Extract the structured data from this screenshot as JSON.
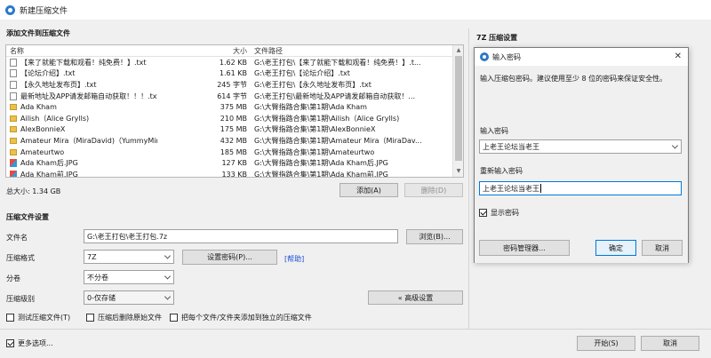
{
  "window": {
    "title": "新建压缩文件"
  },
  "add_files": {
    "section_label": "添加文件到压缩文件",
    "columns": {
      "name": "名称",
      "size": "大小",
      "path": "文件路径"
    },
    "rows": [
      {
        "name": "【来了就能下载和观看！纯免费！】.txt",
        "size": "1.62 KB",
        "path": "G:\\老王打包\\【来了就能下载和观看！纯免费！】.t...",
        "type": "txt"
      },
      {
        "name": "【论坛介绍】.txt",
        "size": "1.61 KB",
        "path": "G:\\老王打包\\【论坛介绍】.txt",
        "type": "txt"
      },
      {
        "name": "【永久地址发布页】.txt",
        "size": "245 字节",
        "path": "G:\\老王打包\\【永久地址发布页】.txt",
        "type": "txt"
      },
      {
        "name": "最新地址及APP请发邮箱自动获取！！！.txt",
        "size": "614 字节",
        "path": "G:\\老王打包\\最新地址及APP请发邮箱自动获取！...",
        "type": "txt"
      },
      {
        "name": "Ada Kham",
        "size": "375 MB",
        "path": "G:\\大臀指路合集\\第1期\\Ada Kham",
        "type": "folder"
      },
      {
        "name": "Ailish（Alice Grylls)",
        "size": "210 MB",
        "path": "G:\\大臀指路合集\\第1期\\Ailish（Alice Grylls)",
        "type": "folder"
      },
      {
        "name": "AlexBonnieX",
        "size": "175 MB",
        "path": "G:\\大臀指路合集\\第1期\\AlexBonnieX",
        "type": "folder"
      },
      {
        "name": "Amateur Mira（MiraDavid)（YummyMira)",
        "size": "432 MB",
        "path": "G:\\大臀指路合集\\第1期\\Amateur Mira（MiraDav...",
        "type": "folder"
      },
      {
        "name": "Amateurtwo",
        "size": "185 MB",
        "path": "G:\\大臀指路合集\\第1期\\Amateurtwo",
        "type": "folder"
      },
      {
        "name": "Ada Kham后.JPG",
        "size": "127 KB",
        "path": "G:\\大臀指路合集\\第1期\\Ada Kham后.JPG",
        "type": "image"
      },
      {
        "name": "Ada Kham前.JPG",
        "size": "133 KB",
        "path": "G:\\大臀指路合集\\第1期\\Ada Kham前.JPG",
        "type": "image"
      }
    ],
    "total": "总大小: 1.34 GB",
    "add_button": "添加(A)",
    "delete_button": "删除(D)"
  },
  "settings": {
    "section_label": "压缩文件设置",
    "filename_label": "文件名",
    "filename_value": "G:\\老王打包\\老王打包.7z",
    "browse_button": "浏览(B)...",
    "format_label": "压缩格式",
    "format_value": "7Z",
    "set_password_button": "设置密码(P)...",
    "help_link": "[帮助]",
    "split_label": "分卷",
    "split_value": "不分卷",
    "level_label": "压缩级别",
    "level_value": "0-仅存储",
    "advanced_button": "« 高级设置",
    "test_checkbox": "测试压缩文件(T)",
    "delete_source_checkbox": "压缩后删除原始文件",
    "separate_checkbox": "把每个文件/文件夹添加到独立的压缩文件"
  },
  "side_panel": {
    "label": "7Z 压缩设置"
  },
  "footer": {
    "more_options": "更多选项...",
    "start_button": "开始(S)",
    "cancel_button": "取消"
  },
  "password_dialog": {
    "title": "输入密码",
    "description": "输入压缩包密码。建议使用至少 8 位的密码来保证安全性。",
    "password_label": "输入密码",
    "password_value": "上老王论坛当老王",
    "confirm_label": "重新输入密码",
    "confirm_value": "上老王论坛当老王",
    "show_password": "显示密码",
    "manager_button": "密码管理器...",
    "ok_button": "确定",
    "cancel_button": "取消"
  }
}
